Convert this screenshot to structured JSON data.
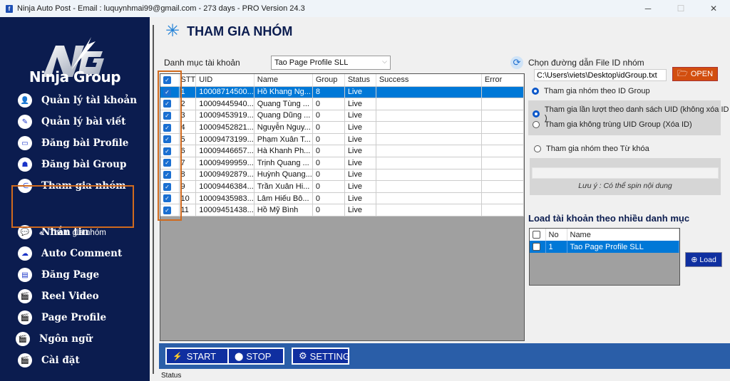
{
  "window": {
    "title": "Ninja Auto Post - Email : luquynhmai99@gmail.com - 273 days -  PRO Version 24.3",
    "app_icon": "facebook-icon",
    "controls": {
      "minimize": "─",
      "maximize": "☐",
      "close": "✕"
    }
  },
  "sidebar": {
    "brand": "Ninja Group",
    "logo_letters": "NG",
    "items": [
      {
        "label": "Quản lý tài khoản",
        "icon": "user-icon",
        "glyph": "👤"
      },
      {
        "label": "Quản lý bài viết",
        "icon": "pen-icon",
        "glyph": "✎"
      },
      {
        "label": "Đăng bài Profile",
        "icon": "monitor-icon",
        "glyph": "▭"
      },
      {
        "label": "Đăng bài Group",
        "icon": "group-icon",
        "glyph": "☗"
      },
      {
        "label": "Tham gia nhóm",
        "icon": "share-nodes-icon",
        "glyph": "⋲"
      },
      {
        "label": "Nhắn tin",
        "icon": "chat-icon",
        "glyph": "💬"
      },
      {
        "label": "Auto Comment",
        "icon": "comment-icon",
        "glyph": "☁"
      },
      {
        "label": "Đăng Page",
        "icon": "document-icon",
        "glyph": "▤"
      },
      {
        "label": "Reel Video",
        "icon": "clapperboard-icon",
        "glyph": "🎬"
      },
      {
        "label": "Page Profile",
        "icon": "clapperboard-icon",
        "glyph": "🎬"
      },
      {
        "label": "Ngôn ngữ",
        "icon": "clapperboard-icon",
        "glyph": "🎬"
      },
      {
        "label": "Cài đặt",
        "icon": "clapperboard-icon",
        "glyph": "🎬"
      }
    ],
    "active_index": 4,
    "sub_item": {
      "label": "Tham gia nhóm",
      "icon": "sitemap-icon",
      "glyph": "♣"
    }
  },
  "main": {
    "title": "THAM GIA NHÓM",
    "title_icon": "snowflake-icon",
    "category_label": "Danh mục tài khoản",
    "category_value": "Tao Page Profile SLL",
    "table": {
      "columns": [
        "",
        "STT",
        "UID",
        "Name",
        "Group",
        "Status",
        "Success",
        "Error"
      ],
      "rows": [
        {
          "stt": "1",
          "uid": "10008714500...",
          "name": "Hồ Khang Ng...",
          "group": "8",
          "status": "Live",
          "success": "",
          "error": "",
          "checked": true,
          "selected": true
        },
        {
          "stt": "2",
          "uid": "10009445940...",
          "name": "Quang Tùng ...",
          "group": "0",
          "status": "Live",
          "success": "",
          "error": "",
          "checked": true
        },
        {
          "stt": "3",
          "uid": "10009453919...",
          "name": "Quang Dũng ...",
          "group": "0",
          "status": "Live",
          "success": "",
          "error": "",
          "checked": true
        },
        {
          "stt": "4",
          "uid": "10009452821...",
          "name": "Nguyễn Nguy...",
          "group": "0",
          "status": "Live",
          "success": "",
          "error": "",
          "checked": true
        },
        {
          "stt": "5",
          "uid": "10009473199...",
          "name": "Phạm Xuân T...",
          "group": "0",
          "status": "Live",
          "success": "",
          "error": "",
          "checked": true
        },
        {
          "stt": "6",
          "uid": "10009446657...",
          "name": "Hà Khanh Ph...",
          "group": "0",
          "status": "Live",
          "success": "",
          "error": "",
          "checked": true
        },
        {
          "stt": "7",
          "uid": "10009499959...",
          "name": "Trịnh Quang ...",
          "group": "0",
          "status": "Live",
          "success": "",
          "error": "",
          "checked": true
        },
        {
          "stt": "8",
          "uid": "10009492879...",
          "name": "Huỳnh Quang...",
          "group": "0",
          "status": "Live",
          "success": "",
          "error": "",
          "checked": true
        },
        {
          "stt": "9",
          "uid": "10009446384...",
          "name": "Trần Xuân Hi...",
          "group": "0",
          "status": "Live",
          "success": "",
          "error": "",
          "checked": true
        },
        {
          "stt": "10",
          "uid": "10009435983...",
          "name": "Lâm Hiếu Bô...",
          "group": "0",
          "status": "Live",
          "success": "",
          "error": "",
          "checked": true
        },
        {
          "stt": "11",
          "uid": "10009451438...",
          "name": "Hồ Mỹ Bình",
          "group": "0",
          "status": "Live",
          "success": "",
          "error": "",
          "checked": true
        }
      ]
    },
    "buttons": {
      "start": {
        "label": "START",
        "icon": "lightning-icon",
        "glyph": "⚡"
      },
      "stop": {
        "label": "STOP",
        "icon": "stop-icon",
        "glyph": "⬤"
      },
      "setting": {
        "label": "SETTING",
        "icon": "gear-icon",
        "glyph": "⚙"
      }
    },
    "status_label": "Status"
  },
  "right_panel": {
    "file_label": "Chọn đường dẫn File ID nhóm",
    "file_path": "C:\\Users\\viets\\Desktop\\idGroup.txt",
    "open_label": "OPEN",
    "radios": [
      {
        "label": "Tham gia nhóm theo ID Group",
        "checked": true
      },
      {
        "label": "Tham gia lần lượt theo danh sách UID (không xóa ID )",
        "checked": true
      },
      {
        "label": "Tham gia không trùng UID Group (Xóa ID)",
        "checked": false
      },
      {
        "label": "Tham gia nhóm theo Từ khóa",
        "checked": false
      }
    ],
    "keyword_value": "",
    "note": "Lưu ý : Có thể spin nội dung",
    "load_title": "Load tài khoản theo nhiều danh mục",
    "category_table": {
      "columns": [
        "",
        "No",
        "Name"
      ],
      "rows": [
        {
          "no": "1",
          "name": "Tao Page Profile SLL",
          "checked": false
        }
      ]
    },
    "load_label": "Load"
  }
}
